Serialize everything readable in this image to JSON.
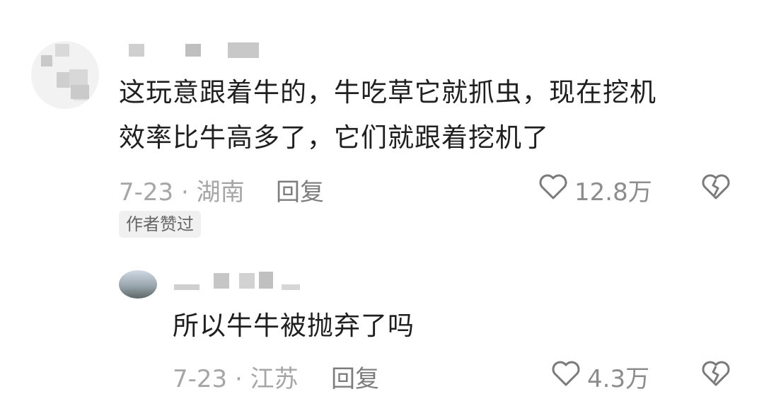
{
  "comments": [
    {
      "text_line1": "这玩意跟着牛的，牛吃草它就抓虫，现在挖机",
      "text_line2": "效率比牛高多了，它们就跟着挖机了",
      "date_loc": "7-23 · 湖南",
      "reply_label": "回复",
      "likes": "12.8万",
      "badge": "作者赞过"
    },
    {
      "text": "所以牛牛被抛弃了吗",
      "date_loc": "7-23 · 江苏",
      "reply_label": "回复",
      "likes": "4.3万"
    }
  ]
}
